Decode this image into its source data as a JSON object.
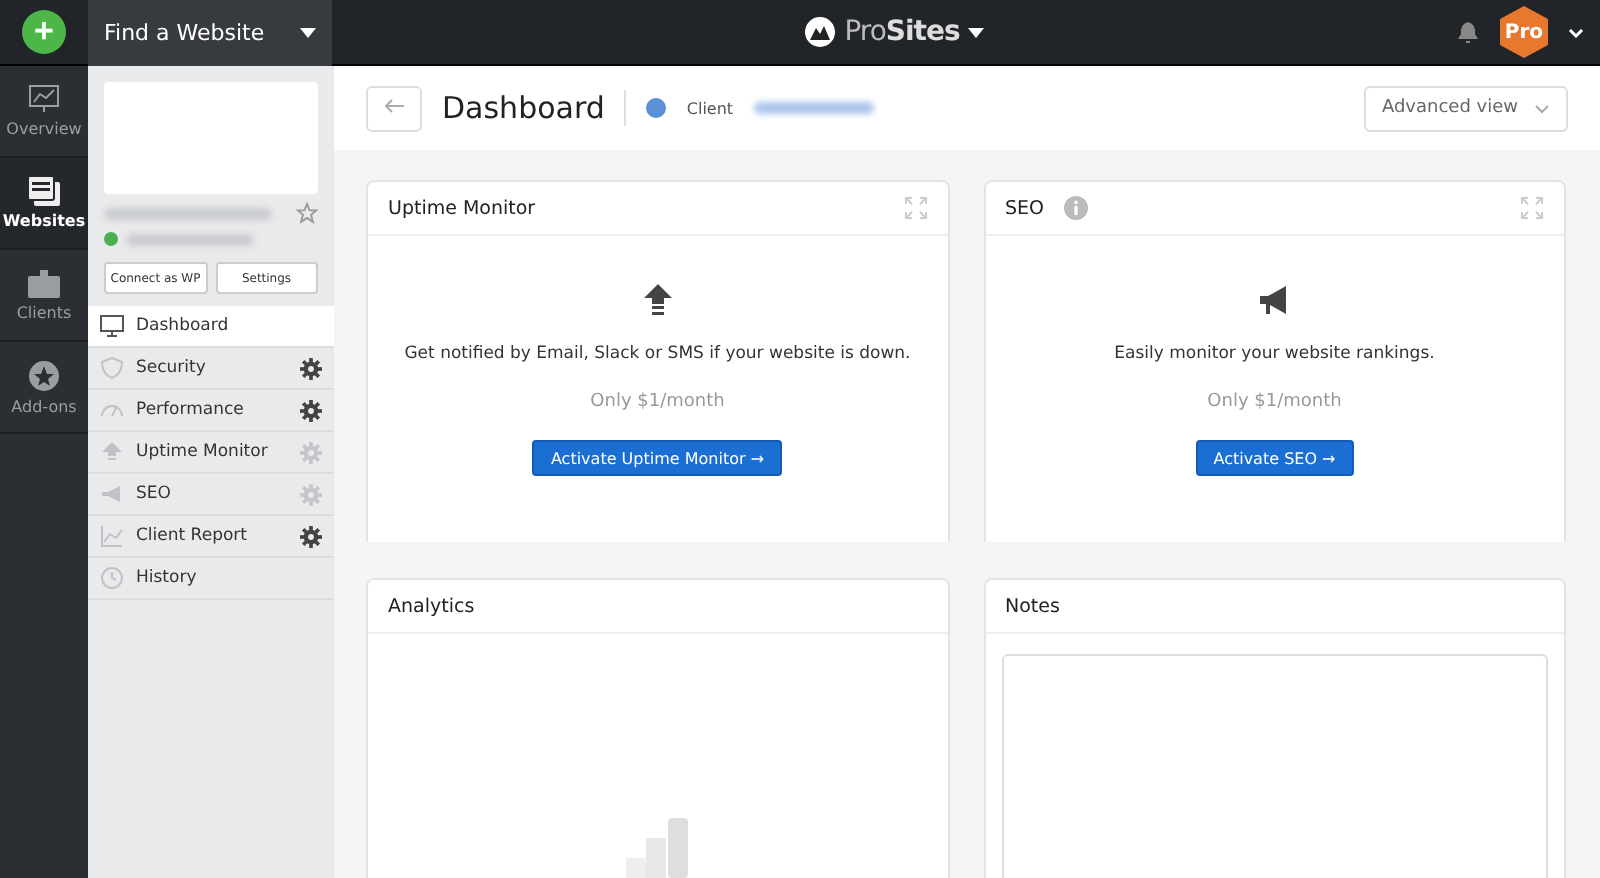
{
  "topbar": {
    "add_label": "+",
    "site_picker": "Find a Website",
    "brand": {
      "part1": "Pro",
      "part2": "Sites"
    },
    "plan_badge": "Pro"
  },
  "rail": [
    {
      "label": "Overview",
      "kind": "chart",
      "selected": false
    },
    {
      "label": "Websites",
      "kind": "sites",
      "selected": true
    },
    {
      "label": "Clients",
      "kind": "clients",
      "selected": false
    },
    {
      "label": "Add-ons",
      "kind": "addons",
      "selected": false
    }
  ],
  "site_panel": {
    "buttons": [
      "Connect as WP",
      "Settings"
    ],
    "starred": false
  },
  "menu": [
    {
      "label": "Dashboard",
      "kind": "monitor",
      "selected": true
    },
    {
      "label": "Security",
      "kind": "shield",
      "settings_enabled": true,
      "selected": false
    },
    {
      "label": "Performance",
      "kind": "gauge",
      "settings_enabled": true,
      "selected": false
    },
    {
      "label": "Uptime Monitor",
      "kind": "arrow",
      "settings_enabled": false,
      "selected": false
    },
    {
      "label": "SEO",
      "kind": "megaphone",
      "settings_enabled": false,
      "selected": false
    },
    {
      "label": "Client Report",
      "kind": "report",
      "settings_enabled": true,
      "selected": false
    },
    {
      "label": "History",
      "kind": "clock",
      "selected": false
    }
  ],
  "header": {
    "title": "Dashboard",
    "client_label": "Client",
    "view_select": "Advanced view"
  },
  "cards": [
    {
      "title": "Uptime Monitor",
      "kind": "uptime",
      "info": false,
      "text": "Get notified by Email, Slack or SMS if your website is down.",
      "price": "Only $1/month",
      "action": "Activate Uptime Monitor",
      "arrow": "→"
    },
    {
      "title": "SEO",
      "kind": "seo",
      "info": true,
      "text": "Easily monitor your website rankings.",
      "price": "Only $1/month",
      "action": "Activate SEO",
      "arrow": "→"
    },
    {
      "title": "Analytics",
      "kind": "analytics",
      "info": false
    },
    {
      "title": "Notes",
      "kind": "notes",
      "info": false
    }
  ]
}
